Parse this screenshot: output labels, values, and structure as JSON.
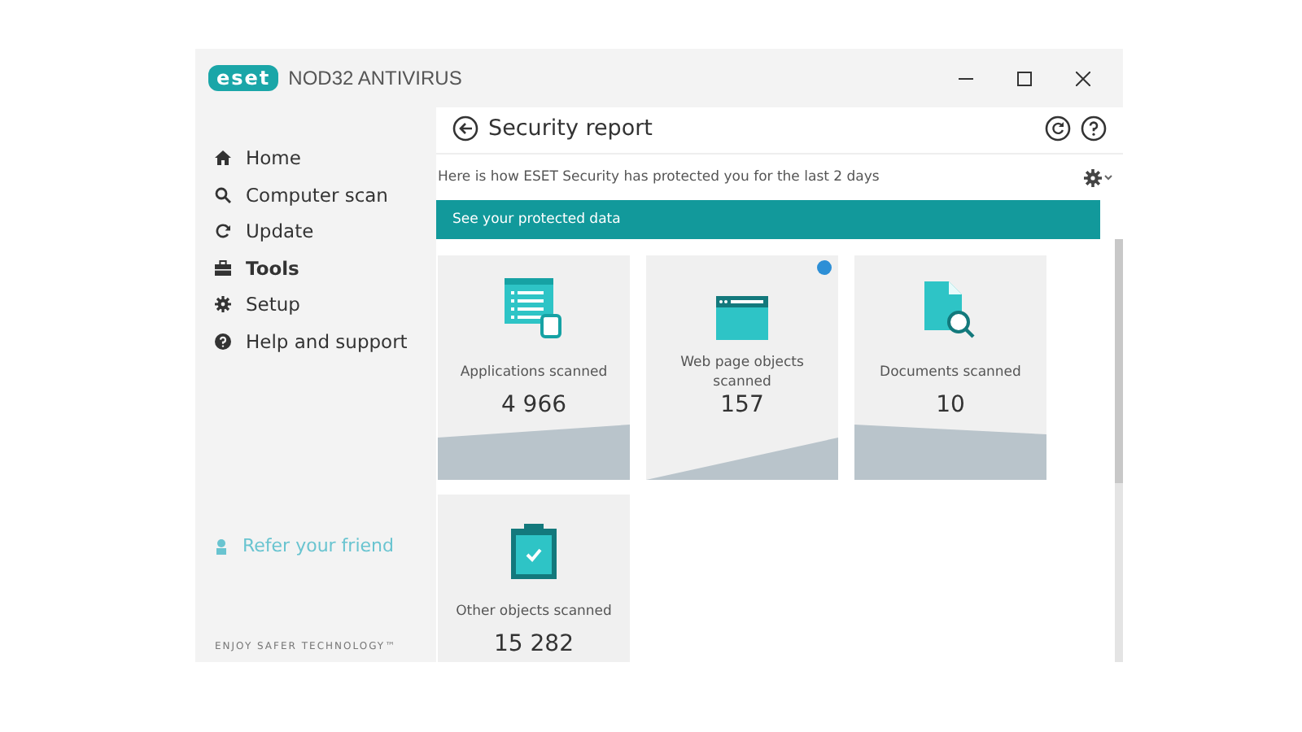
{
  "window": {
    "logo": "eset",
    "product": "NOD32 ANTIVIRUS"
  },
  "sidebar": {
    "items": [
      {
        "label": "Home",
        "selected": false
      },
      {
        "label": "Computer scan",
        "selected": false
      },
      {
        "label": "Update",
        "selected": false
      },
      {
        "label": "Tools",
        "selected": true
      },
      {
        "label": "Setup",
        "selected": false
      },
      {
        "label": "Help and support",
        "selected": false
      }
    ],
    "refer_link": "Refer your friend",
    "footer": "ENJOY SAFER TECHNOLOGY™"
  },
  "header": {
    "title": "Security report",
    "subtitle": "Here is how ESET Security has protected you for the last 2 days",
    "banner": "See your protected data"
  },
  "cards": [
    {
      "kind": "applications",
      "label": "Applications scanned",
      "value": "4 966",
      "info": false
    },
    {
      "kind": "web",
      "label": "Web page objects scanned",
      "value": "157",
      "info": true
    },
    {
      "kind": "documents",
      "label": "Documents scanned",
      "value": "10",
      "info": false
    },
    {
      "kind": "other",
      "label": "Other objects scanned",
      "value": "15 282",
      "info": false
    }
  ]
}
